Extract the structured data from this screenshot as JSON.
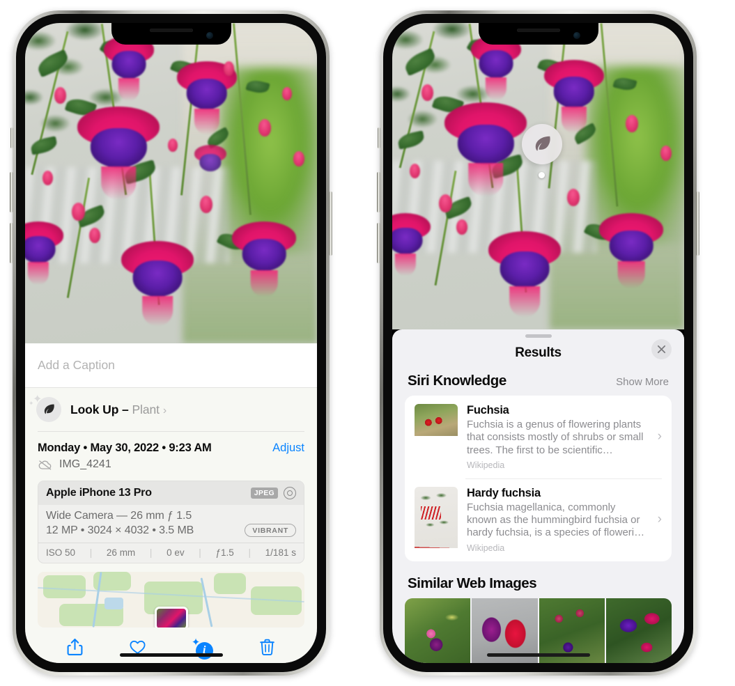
{
  "left_phone": {
    "photo": {
      "alt": "fuchsia-flowers-photo"
    },
    "caption": {
      "placeholder": "Add a Caption",
      "value": ""
    },
    "lookup": {
      "icon": "leaf-icon",
      "sparkle_icon": "sparkles-icon",
      "label": "Look Up – ",
      "subject": "Plant",
      "chevron": "›"
    },
    "metadata": {
      "date": "Monday • May 30, 2022 • 9:23 AM",
      "adjust_label": "Adjust",
      "cloud_icon": "cloud-slash-icon",
      "filename": "IMG_4241"
    },
    "exif": {
      "model": "Apple iPhone 13 Pro",
      "format_badge": "JPEG",
      "raw_icon": "aperture-icon",
      "lens": "Wide Camera — 26 mm ƒ 1.5",
      "size_line": "12 MP  •  3024 × 4032  •  3.5 MB",
      "style_badge": "VIBRANT",
      "stats": [
        {
          "label": "ISO 50"
        },
        {
          "label": "26 mm"
        },
        {
          "label": "0 ev"
        },
        {
          "label": "ƒ1.5"
        },
        {
          "label": "1/181 s"
        }
      ],
      "separator": "|"
    },
    "map": {
      "name": "photo-location-map",
      "pin": "photo-pin"
    },
    "toolbar": [
      {
        "name": "share-icon",
        "label": "Share"
      },
      {
        "name": "heart-icon",
        "label": "Favorite"
      },
      {
        "name": "info-icon",
        "label": "Info",
        "glyph": "i",
        "active": true
      },
      {
        "name": "trash-icon",
        "label": "Delete"
      }
    ],
    "accent_color": "#0a84ff"
  },
  "right_phone": {
    "visual_lookup_badge": {
      "icon": "leaf-icon"
    },
    "results": {
      "title": "Results",
      "close_icon": "close-icon",
      "grabber": "sheet-grabber",
      "siri_knowledge": {
        "title": "Siri Knowledge",
        "show_more": "Show More",
        "items": [
          {
            "name": "Fuchsia",
            "description": "Fuchsia is a genus of flowering plants that consists mostly of shrubs or small trees. The first to be scientific…",
            "source": "Wikipedia",
            "thumb": "fuchsia-red-flowers-thumb",
            "chevron": "›"
          },
          {
            "name": "Hardy fuchsia",
            "description": "Fuchsia magellanica, commonly known as the hummingbird fuchsia or hardy fuchsia, is a species of floweri…",
            "source": "Wikipedia",
            "thumb": "hardy-fuchsia-specimen-thumb",
            "chevron": "›"
          }
        ]
      },
      "similar_web_images": {
        "title": "Similar Web Images",
        "tiles": [
          {
            "name": "web-image-pink-purple-fuchsia"
          },
          {
            "name": "web-image-red-magenta-fuchsia"
          },
          {
            "name": "web-image-fuchsia-bush"
          },
          {
            "name": "web-image-purple-red-fuchsia"
          }
        ]
      }
    }
  }
}
